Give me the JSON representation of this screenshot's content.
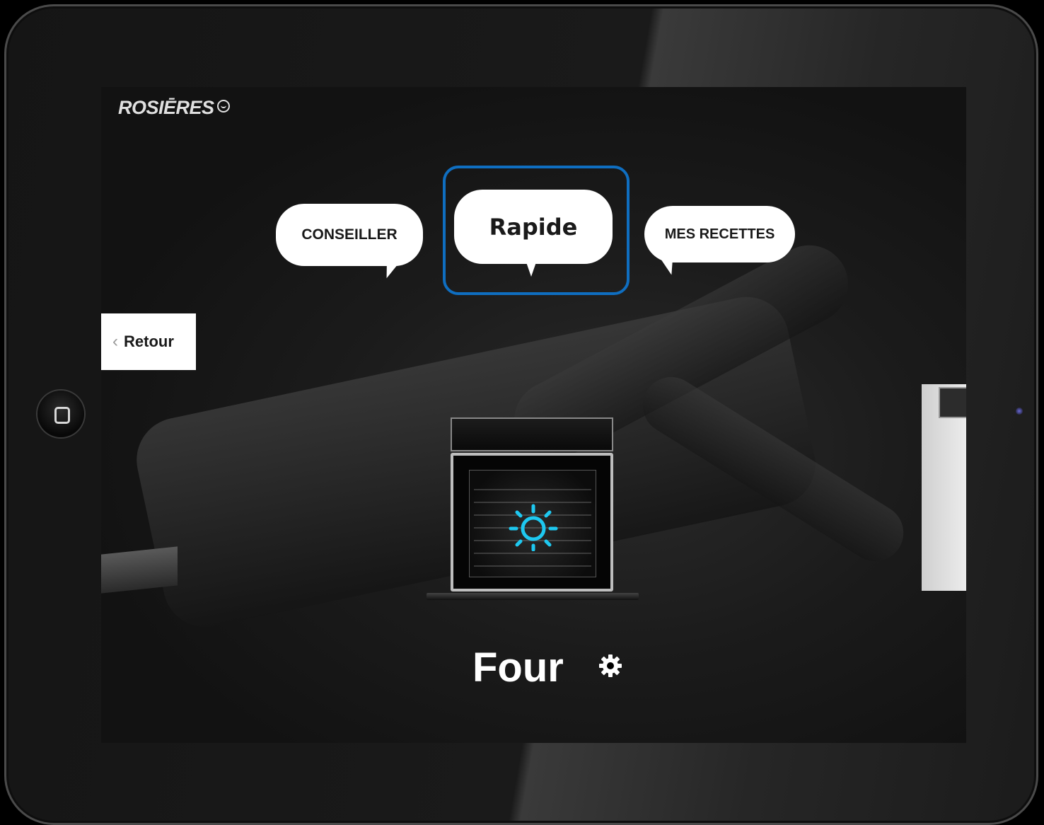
{
  "brand": {
    "logo_text": "ROSIĒRES"
  },
  "modes": {
    "conseiller": "CONSEILLER",
    "rapide": "Rapide",
    "mes_recettes": "MES RECETTES"
  },
  "navigation": {
    "back_chevron": "‹",
    "back_label": "Retour"
  },
  "product": {
    "title": "Four",
    "settings_icon": "gear-icon"
  },
  "colors": {
    "selection_outline": "#0f6ec0",
    "oven_indicator": "#1ec8f0"
  }
}
